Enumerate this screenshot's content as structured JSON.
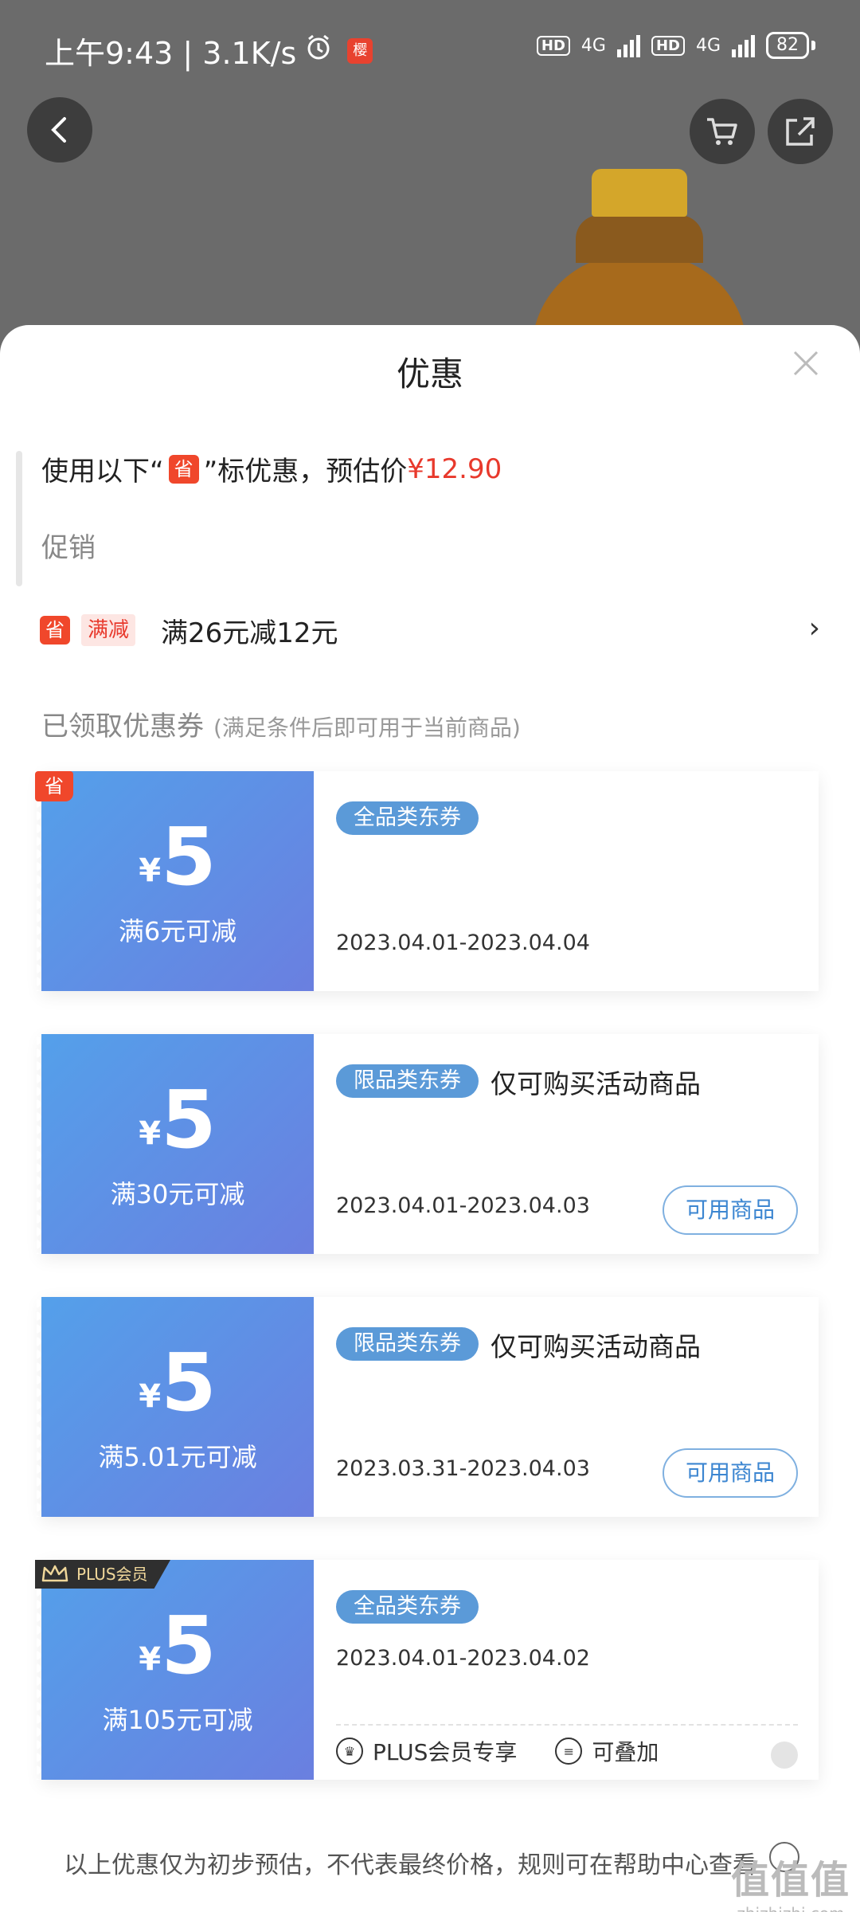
{
  "status_bar": {
    "time_speed": "上午9:43 | 3.1K/s",
    "app_badge": "樱",
    "hd1": "HD",
    "net1": "4G",
    "hd2": "HD",
    "net2": "4G",
    "battery": "82"
  },
  "header": {
    "back_icon": "back-arrow-icon",
    "cart_icon": "cart-icon",
    "share_icon": "share-icon"
  },
  "sheet": {
    "title": "优惠",
    "estimate": {
      "prefix": "使用以下“",
      "tag": "省",
      "suffix": "”标优惠，预估价",
      "price": "¥12.90"
    },
    "promo_heading": "促销",
    "promo": {
      "tag_icon": "省",
      "type": "满减",
      "text": "满26元减12元"
    },
    "coupons_heading": "已领取优惠券",
    "coupons_subheading": "(满足条件后即可用于当前商品)",
    "coupons": [
      {
        "badge": "省",
        "yen": "¥",
        "amount": "5",
        "condition": "满6元可减",
        "tag": "全品类东券",
        "note": "",
        "date": "2023.04.01-2023.04.04"
      },
      {
        "yen": "¥",
        "amount": "5",
        "condition": "满30元可减",
        "tag": "限品类东券",
        "note": "仅可购买活动商品",
        "date": "2023.04.01-2023.04.03",
        "button": "可用商品"
      },
      {
        "yen": "¥",
        "amount": "5",
        "condition": "满5.01元可减",
        "tag": "限品类东券",
        "note": "仅可购买活动商品",
        "date": "2023.03.31-2023.04.03",
        "button": "可用商品"
      },
      {
        "badge": "PLUS会员",
        "yen": "¥",
        "amount": "5",
        "condition": "满105元可减",
        "tag": "全品类东券",
        "date": "2023.04.01-2023.04.02",
        "feature1": "PLUS会员专享",
        "feature2": "可叠加"
      }
    ],
    "footer": "以上优惠仅为初步预估，不代表最终价格，规则可在帮助中心查看"
  },
  "watermark": {
    "big": "值值值",
    "small": "zhizhizhi.com"
  }
}
